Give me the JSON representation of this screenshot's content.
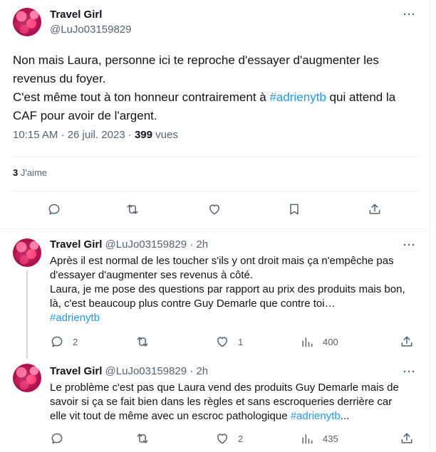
{
  "main_tweet": {
    "author_name": "Travel Girl",
    "author_handle": "@LuJo03159829",
    "text_lines": [
      "Non mais Laura, personne ici te reproche d'essayer d'augmenter les",
      "revenus du foyer.",
      "C'est même tout à ton honneur contrairement à ",
      " qui attend la",
      "CAF pour avoir de l'argent."
    ],
    "hashtag": "#adrienytb",
    "time": "10:15 AM · 26 juil. 2023 · ",
    "views_count": "399",
    "views_label": " vues",
    "likes_count": "3",
    "likes_label": " J'aime",
    "actions": [
      "reply",
      "retweet",
      "like",
      "bookmark",
      "share"
    ]
  },
  "replies": [
    {
      "author_name": "Travel Girl",
      "handle_time": "@LuJo03159829 · 2h",
      "text_lines": [
        "Après il est normal de les toucher s'ils y ont droit mais ça n'empêche pas",
        "d'essayer d'augmenter ses revenus à côté.",
        "Laura, je me pose des questions par rapport au prix des produits mais bon,",
        "là, c'est beaucoup plus contre Guy Demarle que contre toi…"
      ],
      "hashtag_line": "#adrienytb",
      "reply_count": "2",
      "retweet_count": "",
      "like_count": "1",
      "view_count": "400"
    },
    {
      "author_name": "Travel Girl",
      "handle_time": "@LuJo03159829 · 2h",
      "text_lines": [
        "Le problème c'est pas que Laura vend des produits Guy Demarle mais de",
        "savoir si ça se fait bien dans les règles et sans escroqueries derrière car",
        "elle vit tout de même avec un escroc pathologique "
      ],
      "hashtag": "#adrienytb",
      "ellipsis": "...",
      "reply_count": "",
      "retweet_count": "",
      "like_count": "2",
      "view_count": "435"
    }
  ],
  "more_label": "···"
}
